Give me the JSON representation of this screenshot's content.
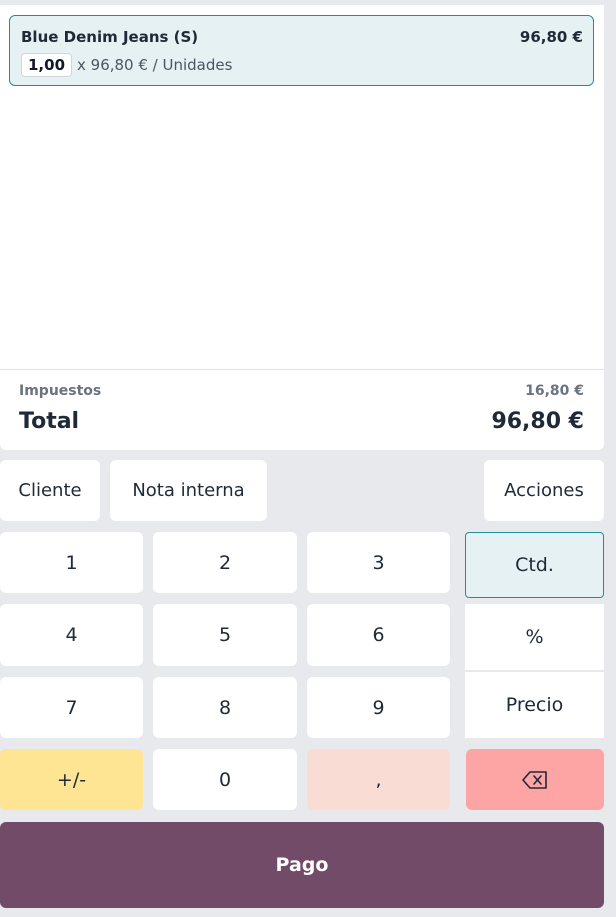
{
  "order": {
    "line": {
      "product_name": "Blue Denim Jeans (S)",
      "price": "96,80 €",
      "quantity": "1,00",
      "unit_info": "x 96,80 € / Unidades"
    },
    "taxes_label": "Impuestos",
    "taxes_value": "16,80 €",
    "total_label": "Total",
    "total_value": "96,80 €"
  },
  "controls": {
    "customer": "Cliente",
    "internal_note": "Nota interna",
    "actions": "Acciones"
  },
  "numpad": {
    "k1": "1",
    "k2": "2",
    "k3": "3",
    "k4": "4",
    "k5": "5",
    "k6": "6",
    "k7": "7",
    "k8": "8",
    "k9": "9",
    "plusminus": "+/-",
    "k0": "0",
    "comma": ","
  },
  "modes": {
    "quantity": "Ctd.",
    "discount": "%",
    "price": "Precio",
    "active": "quantity"
  },
  "backspace_icon": "backspace-icon",
  "payment_label": "Pago",
  "colors": {
    "accent": "#1f8f95",
    "payment": "#714b67",
    "plusminus": "#fde594",
    "comma": "#f9ddd4",
    "backspace": "#fda4a4"
  }
}
